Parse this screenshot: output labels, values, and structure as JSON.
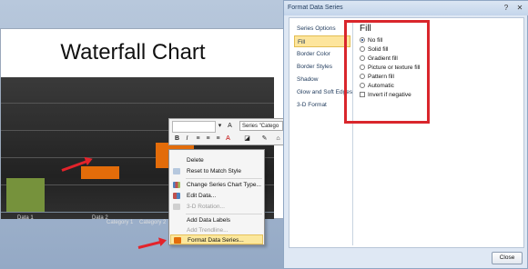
{
  "slide": {
    "title": "Waterfall Chart",
    "category_labels": [
      "Data 1",
      "Data 2",
      "Category 1",
      "Category 2"
    ]
  },
  "colors": {
    "bar_green": "#76923c",
    "bar_orange": "#e36c0a",
    "bar_peach": "#fbd5b5",
    "highlight": "#fbe79c",
    "callout_red": "#d9262c"
  },
  "mini_toolbar": {
    "series_select": "Series \"Catego",
    "buttons": [
      "B",
      "I",
      "A"
    ]
  },
  "context_menu": {
    "items": [
      {
        "label": "Delete",
        "disabled": false,
        "icon": "delete-icon"
      },
      {
        "label": "Reset to Match Style",
        "disabled": false,
        "icon": "reset-icon"
      },
      {
        "label": "Change Series Chart Type...",
        "disabled": false,
        "icon": "chart-type-icon"
      },
      {
        "label": "Edit Data...",
        "disabled": false,
        "icon": "edit-data-icon"
      },
      {
        "label": "3-D Rotation...",
        "disabled": true,
        "icon": "rotation-icon"
      },
      {
        "label": "Add Data Labels",
        "disabled": false,
        "icon": ""
      },
      {
        "label": "Add Trendline...",
        "disabled": true,
        "icon": ""
      },
      {
        "label": "Format Data Series...",
        "disabled": false,
        "icon": "format-series-icon",
        "highlighted": true
      }
    ]
  },
  "dialog": {
    "title": "Format Data Series",
    "nav": [
      "Series Options",
      "Fill",
      "Border Color",
      "Border Styles",
      "Shadow",
      "Glow and Soft Edges",
      "3-D Format"
    ],
    "selected_nav": "Fill",
    "fill_heading": "Fill",
    "fill_options": [
      {
        "label": "No fill",
        "selected": true
      },
      {
        "label": "Solid fill",
        "selected": false
      },
      {
        "label": "Gradient fill",
        "selected": false
      },
      {
        "label": "Picture or texture fill",
        "selected": false
      },
      {
        "label": "Pattern fill",
        "selected": false
      },
      {
        "label": "Automatic",
        "selected": false
      }
    ],
    "invert_label": "Invert if negative",
    "close_label": "Close"
  }
}
